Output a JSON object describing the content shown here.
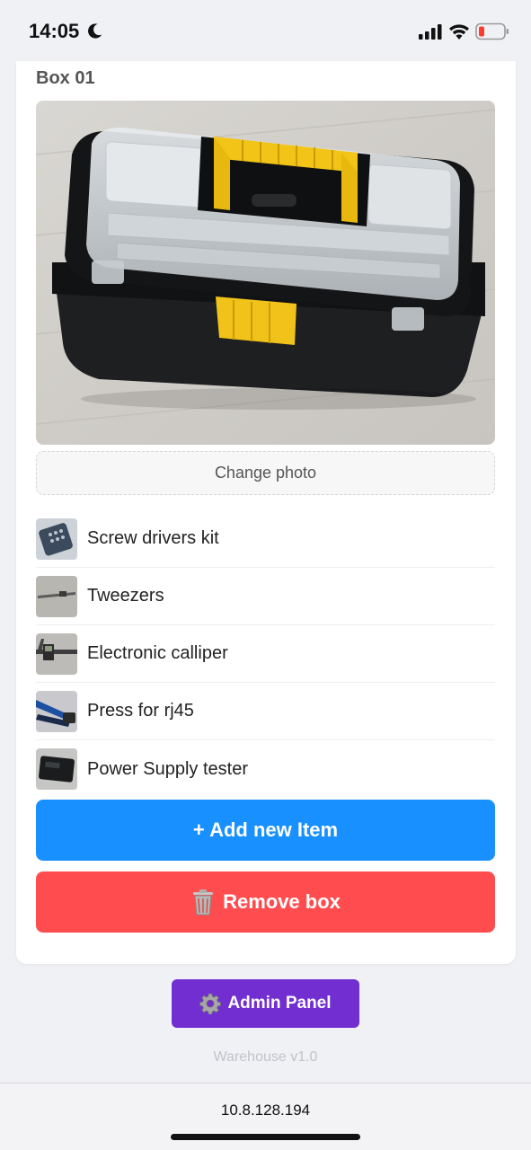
{
  "status_bar": {
    "time": "14:05",
    "icons": [
      "moon-icon",
      "signal-icon",
      "wifi-icon",
      "battery-low-icon"
    ]
  },
  "box": {
    "title": "Box 01",
    "change_photo_label": "Change photo",
    "items": [
      {
        "name": "Screw drivers kit",
        "thumb": "screwdriver-kit-thumbnail"
      },
      {
        "name": "Tweezers",
        "thumb": "tweezers-thumbnail"
      },
      {
        "name": "Electronic calliper",
        "thumb": "calliper-thumbnail"
      },
      {
        "name": "Press for rj45",
        "thumb": "rj45-press-thumbnail"
      },
      {
        "name": "Power Supply tester",
        "thumb": "psu-tester-thumbnail"
      }
    ],
    "add_item_label": "+ Add new Item",
    "remove_box_label": "Remove box"
  },
  "admin": {
    "label": "Admin Panel"
  },
  "footer": {
    "version": "Warehouse v1.0"
  },
  "browser": {
    "url": "10.8.128.194"
  },
  "colors": {
    "add_button": "#1890ff",
    "remove_button": "#ff4d4f",
    "admin_button": "#722ed1",
    "background": "#f0f1f5"
  }
}
